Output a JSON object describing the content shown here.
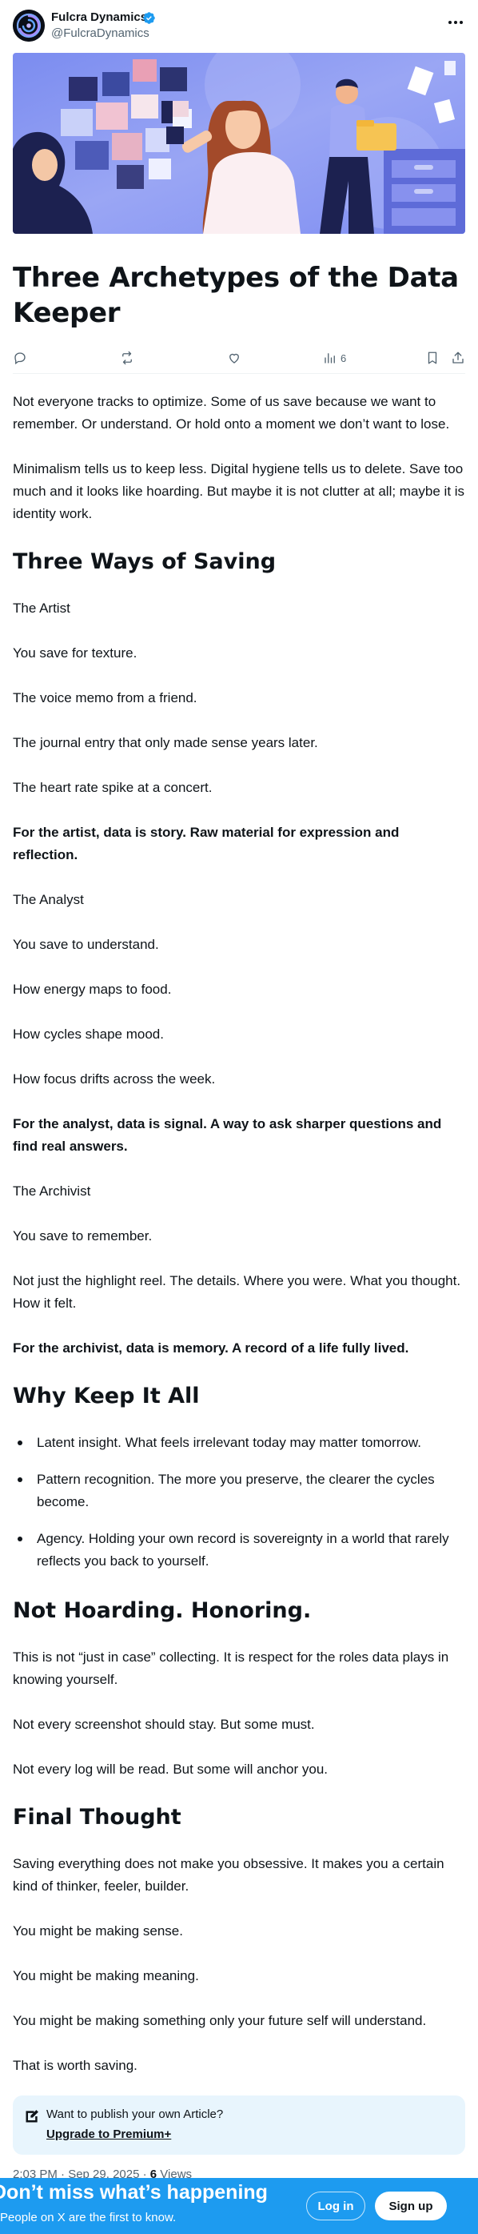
{
  "author": {
    "name": "Fulcra Dynamics",
    "handle": "@FulcraDynamics"
  },
  "article": {
    "title": "Three Archetypes of the Data Keeper",
    "views_count": "6",
    "blocks": [
      {
        "type": "p",
        "text": "Not everyone tracks to optimize. Some of us save because we want to remember. Or understand. Or hold onto a moment we don’t want to lose."
      },
      {
        "type": "p",
        "text": "Minimalism tells us to keep less. Digital hygiene tells us to delete. Save too much and it looks like hoarding. But maybe it is not clutter at all; maybe it is identity work."
      },
      {
        "type": "h2",
        "text": "Three Ways of Saving"
      },
      {
        "type": "p",
        "text": "The Artist"
      },
      {
        "type": "p",
        "text": "You save for texture."
      },
      {
        "type": "p",
        "text": "The voice memo from a friend."
      },
      {
        "type": "p",
        "text": "The journal entry that only made sense years later."
      },
      {
        "type": "p",
        "text": "The heart rate spike at a concert."
      },
      {
        "type": "pb",
        "text": "For the artist, data is story. Raw material for expression and reflection."
      },
      {
        "type": "p",
        "text": "The Analyst"
      },
      {
        "type": "p",
        "text": "You save to understand."
      },
      {
        "type": "p",
        "text": "How energy maps to food."
      },
      {
        "type": "p",
        "text": "How cycles shape mood."
      },
      {
        "type": "p",
        "text": "How focus drifts across the week."
      },
      {
        "type": "pb",
        "text": "For the analyst, data is signal. A way to ask sharper questions and find real answers."
      },
      {
        "type": "p",
        "text": "The Archivist"
      },
      {
        "type": "p",
        "text": "You save to remember."
      },
      {
        "type": "p",
        "text": "Not just the highlight reel. The details. Where you were. What you thought. How it felt."
      },
      {
        "type": "pb",
        "text": "For the archivist, data is memory. A record of a life fully lived."
      },
      {
        "type": "h2",
        "text": "Why Keep It All"
      },
      {
        "type": "ul",
        "items": [
          "Latent insight. What feels irrelevant today may matter tomorrow.",
          "Pattern recognition. The more you preserve, the clearer the cycles become.",
          "Agency. Holding your own record is sovereignty in a world that rarely reflects you back to yourself."
        ]
      },
      {
        "type": "h2",
        "text": "Not Hoarding. Honoring."
      },
      {
        "type": "p",
        "text": "This is not “just in case” collecting. It is respect for the roles data plays in knowing yourself."
      },
      {
        "type": "p",
        "text": "Not every screenshot should stay. But some must."
      },
      {
        "type": "p",
        "text": "Not every log will be read. But some will anchor you."
      },
      {
        "type": "h2",
        "text": "Final Thought"
      },
      {
        "type": "p",
        "text": "Saving everything does not make you obsessive. It makes you a certain kind of thinker, feeler, builder."
      },
      {
        "type": "p",
        "text": "You might be making sense."
      },
      {
        "type": "p",
        "text": "You might be making meaning."
      },
      {
        "type": "p",
        "text": "You might be making something only your future self will understand."
      },
      {
        "type": "p",
        "text": "That is worth saving."
      }
    ]
  },
  "premium_promo": {
    "text": "Want to publish your own Article?",
    "link": "Upgrade to Premium+"
  },
  "meta": {
    "timestamp": "2:03 PM · Sep 29, 2025 · ",
    "views_number": "6",
    "views_label": " Views"
  },
  "banner": {
    "title": "Don’t miss what’s happening",
    "subtitle": "People on X are the first to know.",
    "login_label": "Log in",
    "signup_label": "Sign up"
  },
  "colors": {
    "accent": "#1d9bf0",
    "verified": "#1d9bf0",
    "muted_text": "#536471",
    "premium_bg": "#e8f5fd"
  },
  "icons": [
    "logo-swirl-icon",
    "verified-badge-icon",
    "more-icon",
    "reply-icon",
    "repost-icon",
    "like-icon",
    "views-icon",
    "bookmark-icon",
    "share-icon",
    "article-compose-icon"
  ]
}
